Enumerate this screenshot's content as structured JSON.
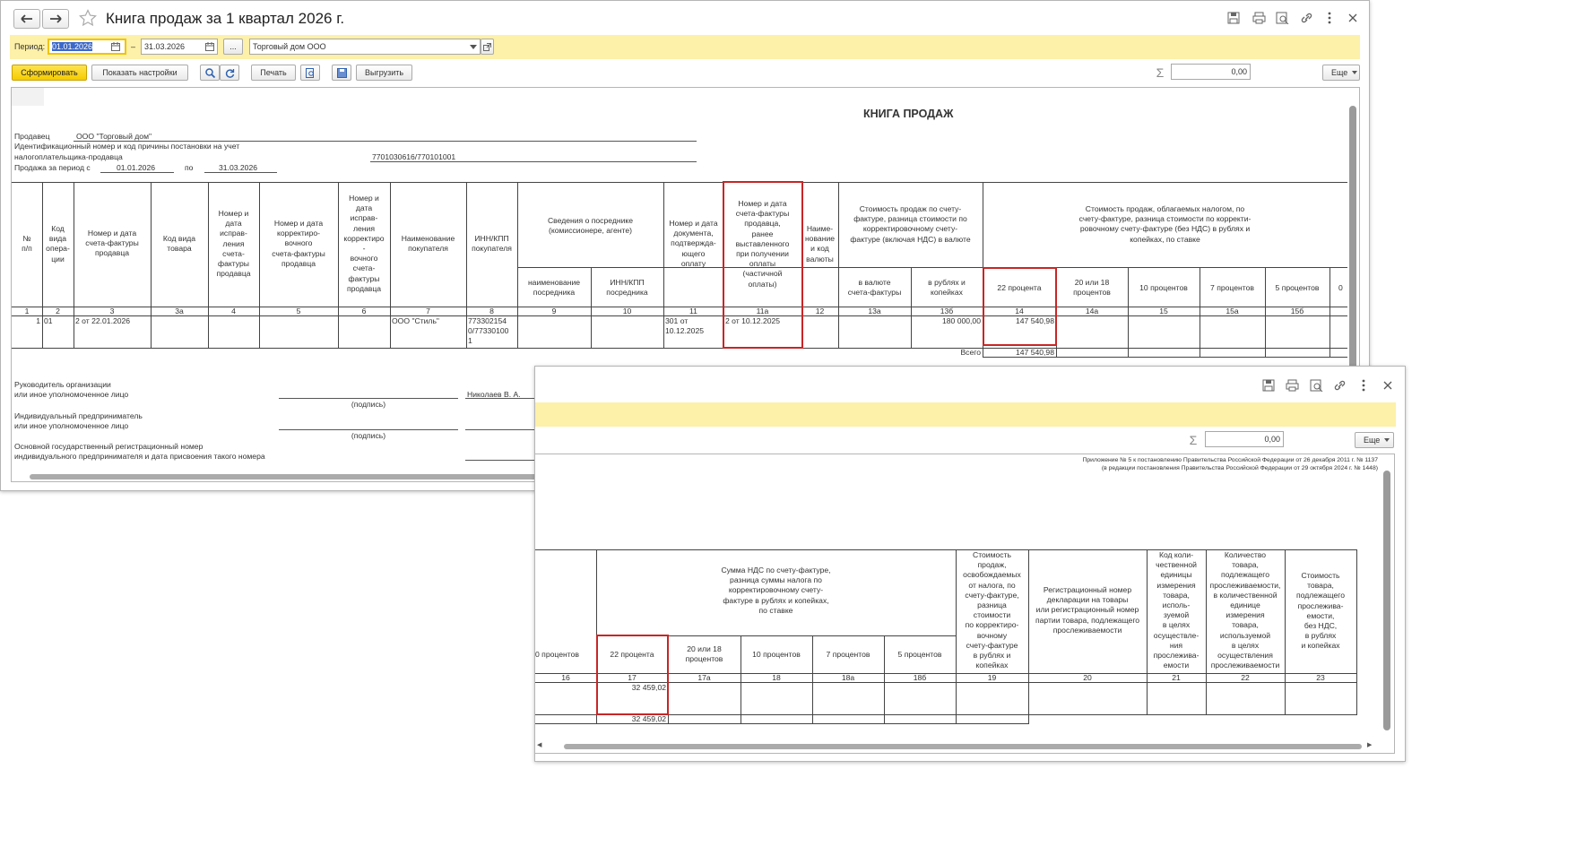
{
  "win1": {
    "title": "Книга продаж за 1 квартал 2026 г.",
    "period_label": "Период:",
    "date_from": "01.01.2026",
    "date_dash": "–",
    "date_to": "31.03.2026",
    "dots_label": "...",
    "org": "Торговый дом ООО",
    "btn_form": "Сформировать",
    "btn_settings": "Показать настройки",
    "btn_print": "Печать",
    "btn_export": "Выгрузить",
    "sum_value": "0,00",
    "more_label": "Еще",
    "doc": {
      "heading": "КНИГА ПРОДАЖ",
      "seller_label": "Продавец",
      "seller_value": "ООО \"Торговый дом\"",
      "inn_line1": "Идентификационный номер и код причины постановки на учет",
      "inn_line2": "налогоплательщика-продавца",
      "inn_value": "7701030616/770101001",
      "period_line": "Продажа за период с",
      "period_from": "01.01.2026",
      "period_to_label": "по",
      "period_to": "31.03.2026",
      "headers": {
        "h1": "№\nп/п",
        "h2": "Код\nвида\nопера-\nции",
        "h3": "Номер и дата\nсчета-фактуры\nпродавца",
        "h3a": "Код вида\nтовара",
        "h4": "Номер и\nдата\nиспрaв-\nления\nсчета-\nфактуры\nпродавца",
        "h5": "Номер и дата\nкорректиро-\nвочного\nсчета-фактуры\nпродавца",
        "h6": "Номер и\nдата\nиспрaв-\nления\nкорректиро\n-\nвочного\nсчета-\nфактуры\nпродавца",
        "h7": "Наименование\nпокупателя",
        "h8": "ИНН/КПП\nпокупателя",
        "h910": "Сведения о посреднике\n(комиссионере, агенте)",
        "h9": "наименование\nпосредника",
        "h10": "ИНН/КПП\nпосредника",
        "h11": "Номер и дата\nдокумента,\nподтвержда-\nющего\nоплату",
        "h11a": "Номер и дата\nсчета-фактуры\nпродавца,\nранее\nвыставленного\nпри получении\nоплаты\n(частичной\nоплаты)",
        "h12": "Наиме-\nнование\nи код\nвалюты",
        "h13": "Стоимость продаж по счету-\nфактуре, разница стоимости по\nкорректировочному счету-\nфактуре (включая НДС) в валюте",
        "h13a": "в валюте\nсчета-фактуры",
        "h13b": "в рублях и\nкопейках",
        "h14g": "Стоимость продаж, облагаемых налогом, по\nсчету-фактуре, разница стоимости по корректи-\nровочному счету-фактуре (без НДС) в рублях и\nкопейках, по ставке",
        "h14": "22 процента",
        "h14a": "20 или 18\nпроцентов",
        "h15": "10 процентов",
        "h15a": "7 процентов",
        "h15b": "5 процентов",
        "h16": "0"
      },
      "colnums": [
        "1",
        "2",
        "3",
        "3а",
        "4",
        "5",
        "6",
        "7",
        "8",
        "9",
        "10",
        "11",
        "11а",
        "12",
        "13а",
        "13б",
        "14",
        "14а",
        "15",
        "15а",
        "15б"
      ],
      "row": {
        "n": "1",
        "code": "01",
        "invoice": "2 от 22.01.2026",
        "buyer": "ООО \"Стиль\"",
        "inn": "773302154\n0/77330100\n1",
        "doc": "301 от\n10.12.2025",
        "prev": "2 от 10.12.2025",
        "rub": "180 000,00",
        "p22": "147 540,98"
      },
      "total_label": "Всего",
      "total_p22": "147 540,98",
      "sig1a": "Руководитель организации",
      "sig1b": "или иное уполномоченное лицо",
      "sign_caption": "(подпись)",
      "sig_name": "Николаев В. А.",
      "sig2a": "Индивидуальный предприниматель",
      "sig2b": "или иное уполномоченное лицо",
      "sign_caption2": "(подпись)",
      "sig3a": "Основной государственный регистрационный номер",
      "sig3b": "индивидуального предпринимателя и дата присвоения такого номера"
    }
  },
  "win2": {
    "sum_value": "0,00",
    "more_label": "Еще",
    "note1": "Приложение № 5 к постановлению Правительства Российской Федерации от 26 декабря 2011 г. № 1137",
    "note2": "(в редакции постановления Правительства Российской Федерации от 29 октября 2024 г. № 1448)",
    "headers": {
      "h16": "0 процентов",
      "hg": "Сумма НДС по счету-фактуре,\nразница суммы налога по\nкорректировочному счету-\nфактуре в рублях и копейках,\nпо ставке",
      "h17": "22 процента",
      "h17a": "20 или 18\nпроцентов",
      "h18": "10 процентов",
      "h18a": "7 процентов",
      "h18b": "5 процентов",
      "h19": "Стоимость\nпродаж,\nосвобождаемых\nот налога, по\nсчету-фактуре,\nразница\nстоимости\nпо корректиро-\nвочному\nсчету-фактуре\nв рублях и\nкопейках",
      "h20": "Регистрационный номер\nдекларации на товары\nили регистрационный номер\nпартии товара, подлежащего\nпрослеживаемости",
      "h21": "Код коли-\nчественной\nединицы\nизмерения\nтовара,\nисполь-\nзуемой\nв целях\nосуществле-\nния\nпрослежива-\nемости",
      "h22": "Количество\nтовара,\nподлежащего\nпрослеживаемости,\nв количественной\nединице\nизмерения\nтовара,\nиспользуемой\nв целях\nосуществления\nпрослеживаемости",
      "h23": "Стоимость\nтовара,\nподлежащего\nпрослежива-\nемости,\nбез НДС,\nв рублях\nи копейках"
    },
    "colnums": [
      "16",
      "17",
      "17а",
      "18",
      "18а",
      "18б",
      "19",
      "20",
      "21",
      "22",
      "23"
    ],
    "row_p22": "32 459,02",
    "total_p22": "32 459,02"
  },
  "icons": [
    "back-arrow-icon",
    "forward-arrow-icon",
    "star-icon",
    "save-icon",
    "printer-icon",
    "preview-icon",
    "link-icon",
    "more-vertical-icon",
    "close-icon",
    "calendar-icon",
    "dropdown-icon",
    "open-icon",
    "search-icon",
    "refresh-icon",
    "sigma-icon"
  ]
}
